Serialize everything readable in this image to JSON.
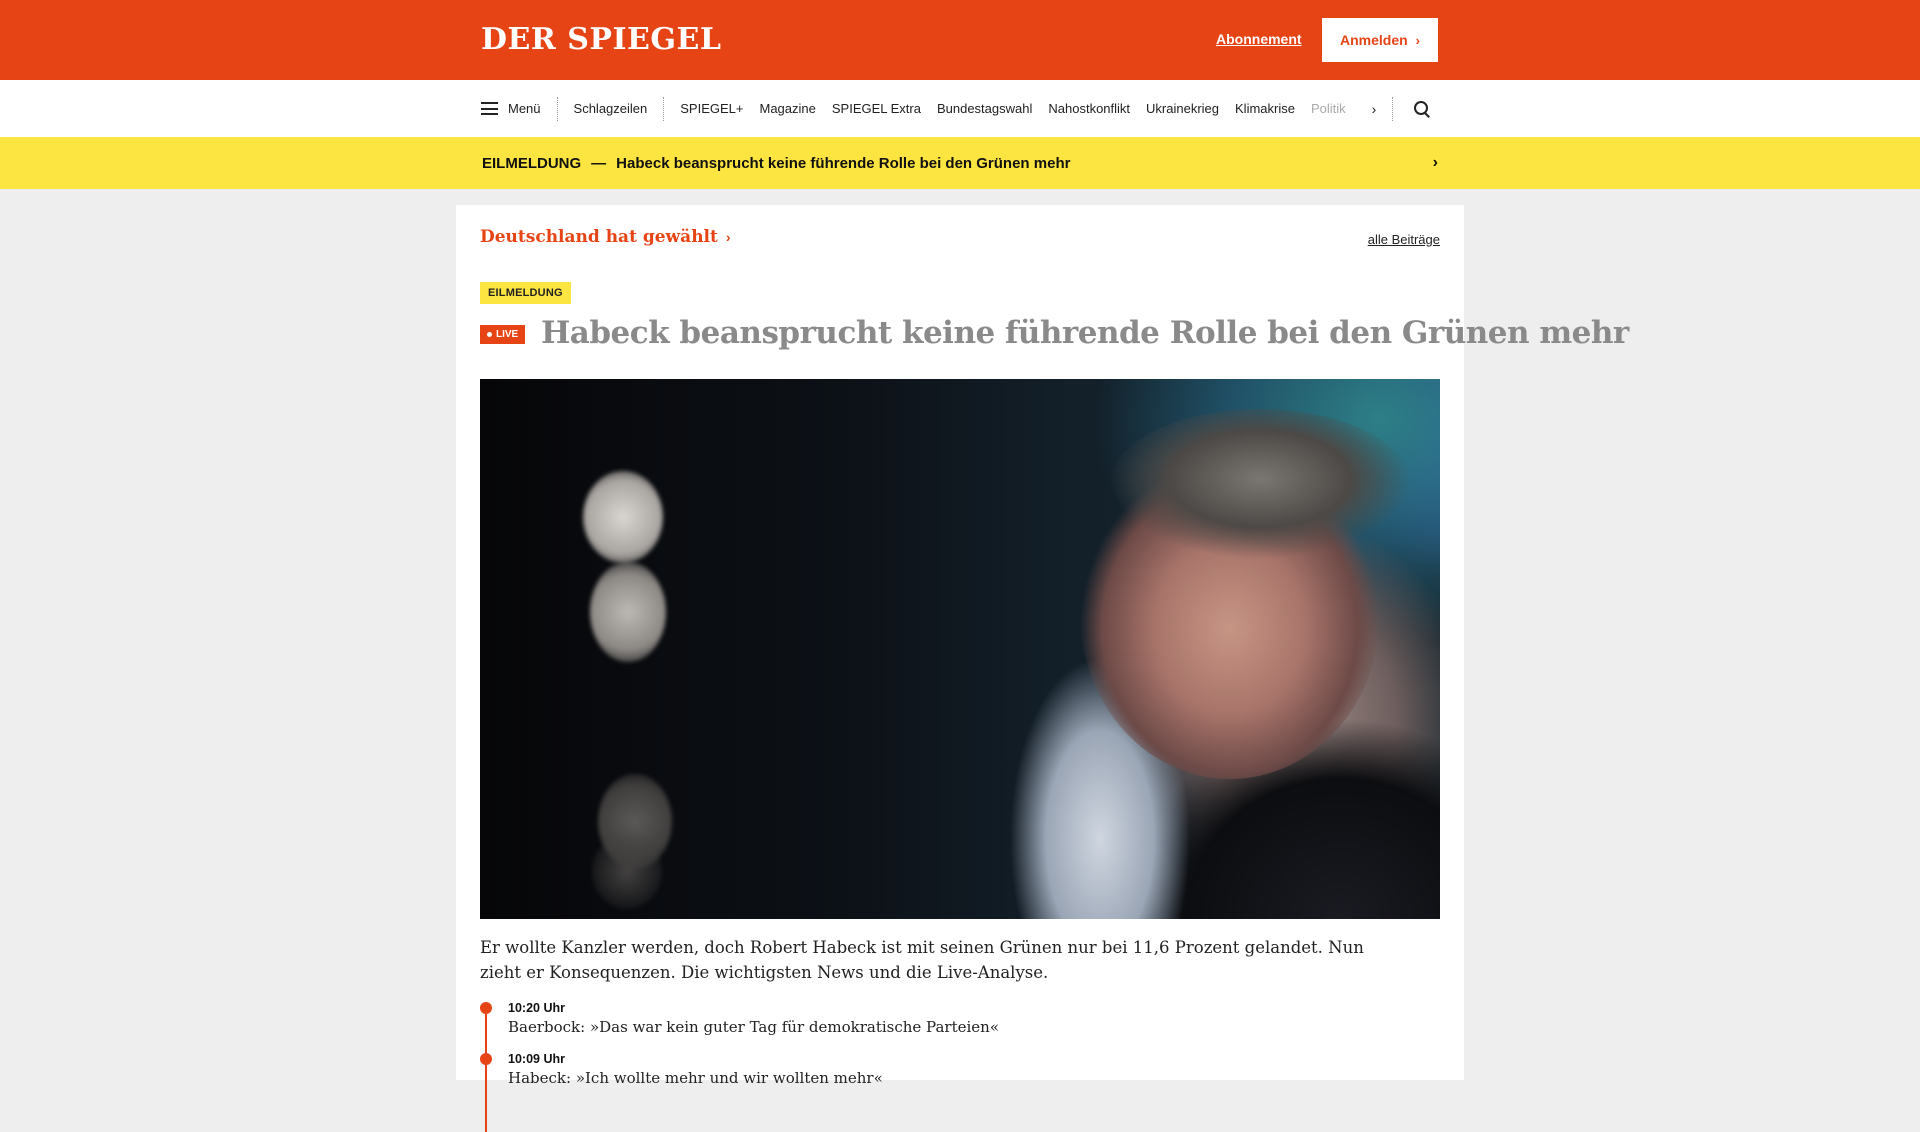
{
  "header": {
    "logo": "DER SPIEGEL",
    "subscription_label": "Abonnement",
    "login_label": "Anmelden",
    "login_icon": "chevron-right-icon",
    "brand_color": "#e64415"
  },
  "nav": {
    "menu_label": "Menü",
    "headlines_label": "Schlagzeilen",
    "items": [
      "SPIEGEL+",
      "Magazine",
      "SPIEGEL Extra",
      "Bundestagswahl",
      "Nahostkonflikt",
      "Ukrainekrieg",
      "Klimakrise"
    ],
    "faded_item": "Politik",
    "more_icon": "chevron-right-icon",
    "search_icon": "search-icon"
  },
  "breaking": {
    "label": "EILMELDUNG",
    "dash": "—",
    "text": "Habeck beansprucht keine führende Rolle bei den Grünen mehr",
    "arrow": "›",
    "color": "#fde541"
  },
  "article": {
    "section": "Deutschland hat gewählt",
    "all_posts": "alle Beiträge",
    "badge": "EILMELDUNG",
    "live_label": "LIVE",
    "headline": "Habeck beansprucht keine führende Rolle bei den Grünen mehr",
    "teaser": "Er wollte Kanzler werden, doch Robert Habeck ist mit seinen Grünen nur bei 11,6 Prozent gelandet. Nun zieht er Konsequenzen. Die wichtigsten News und die Live-Analyse.",
    "timeline": [
      {
        "time": "10:20 Uhr",
        "text": "Baerbock: »Das war kein guter Tag für demokratische Parteien«"
      },
      {
        "time": "10:09 Uhr",
        "text": "Habeck: »Ich wollte mehr und wir wollten mehr«"
      }
    ]
  }
}
